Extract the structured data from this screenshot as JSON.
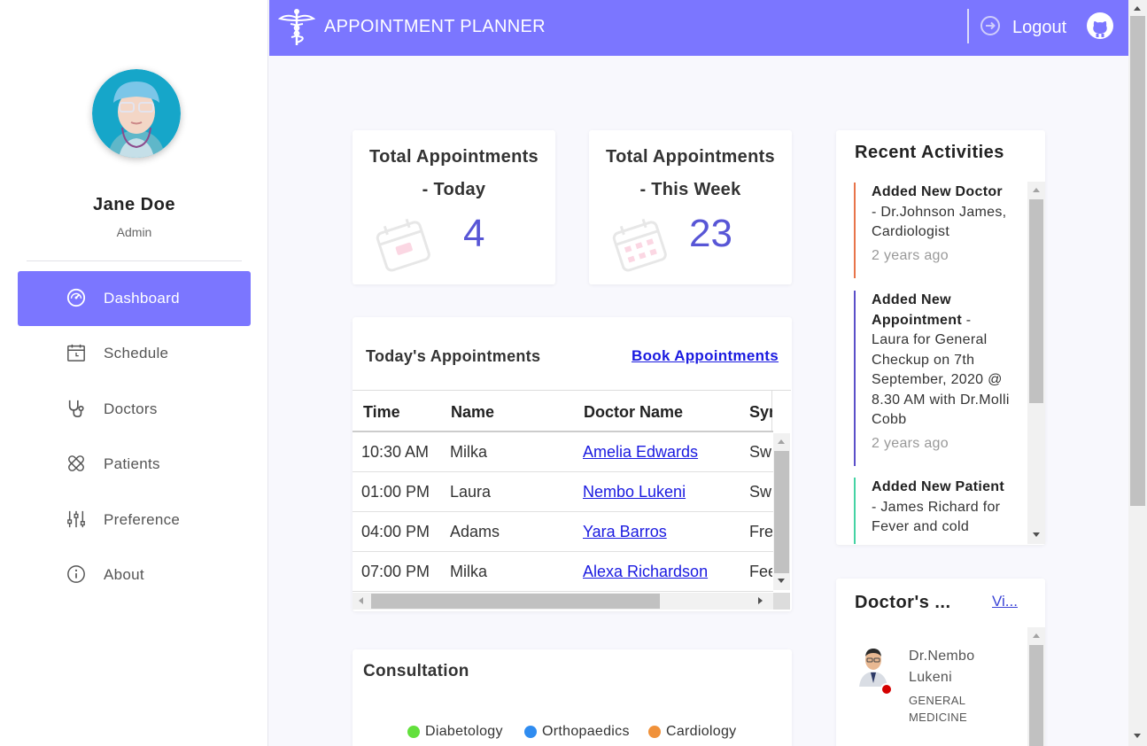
{
  "app": {
    "title": "APPOINTMENT PLANNER",
    "logout_label": "Logout",
    "accent": "#7b76ff"
  },
  "user": {
    "name": "Jane Doe",
    "role": "Admin"
  },
  "sidebar": {
    "items": [
      {
        "label": "Dashboard",
        "icon": "dashboard-icon",
        "active": true
      },
      {
        "label": "Schedule",
        "icon": "calendar-icon"
      },
      {
        "label": "Doctors",
        "icon": "stethoscope-icon"
      },
      {
        "label": "Patients",
        "icon": "bandage-icon"
      },
      {
        "label": "Preference",
        "icon": "sliders-icon"
      },
      {
        "label": "About",
        "icon": "info-icon"
      }
    ]
  },
  "stats": {
    "today": {
      "title_line1": "Total Appointments",
      "title_line2": "- Today",
      "value": "4"
    },
    "week": {
      "title_line1": "Total Appointments",
      "title_line2": "- This Week",
      "value": "23"
    }
  },
  "appointments": {
    "title": "Today's Appointments",
    "link_label": "Book Appointments",
    "columns": [
      "Time",
      "Name",
      "Doctor Name",
      "Sym"
    ],
    "rows": [
      {
        "time": "10:30 AM",
        "name": "Milka",
        "doctor": "Amelia Edwards",
        "symptom": "Sw"
      },
      {
        "time": "01:00 PM",
        "name": "Laura",
        "doctor": "Nembo Lukeni",
        "symptom": "Sw"
      },
      {
        "time": "04:00 PM",
        "name": "Adams",
        "doctor": "Yara Barros",
        "symptom": "Fre"
      },
      {
        "time": "07:00 PM",
        "name": "Milka",
        "doctor": "Alexa Richardson",
        "symptom": "Fee"
      }
    ]
  },
  "consultation": {
    "title": "Consultation",
    "legend": [
      {
        "label": "Diabetology",
        "color": "#62e03c"
      },
      {
        "label": "Orthopaedics",
        "color": "#2f8cf0"
      },
      {
        "label": "Cardiology",
        "color": "#f0913a"
      }
    ]
  },
  "activities": {
    "title": "Recent Activities",
    "items": [
      {
        "bold": "Added New Doctor",
        "text": " - Dr.Johnson James, Cardiologist",
        "time": "2 years ago",
        "color": "#e8744a"
      },
      {
        "bold": "Added New Appointment",
        "text": " - Laura for General Checkup on 7th September, 2020 @ 8.30 AM with Dr.Molli Cobb",
        "time": "2 years ago",
        "color": "#5b4fc9"
      },
      {
        "bold": "Added New Patient",
        "text": " - James Richard for Fever and cold",
        "time": "",
        "color": "#44d3a4"
      }
    ]
  },
  "doctors": {
    "title": "Doctor's ...",
    "view_label": "Vi...",
    "list": [
      {
        "name": "Dr.Nembo Lukeni",
        "specialty": "GENERAL MEDICINE",
        "status_color": "#d40000"
      }
    ]
  }
}
